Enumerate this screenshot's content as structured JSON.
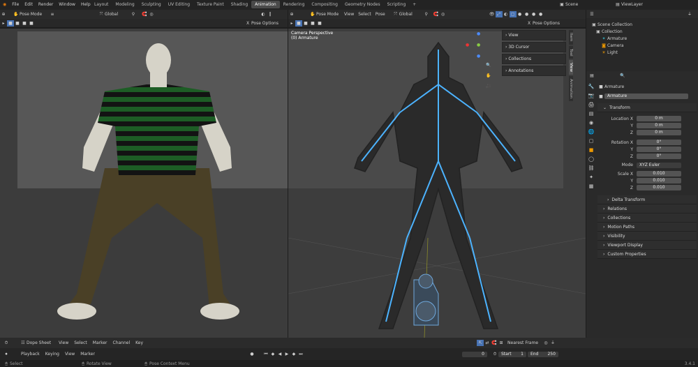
{
  "menu": [
    "File",
    "Edit",
    "Render",
    "Window",
    "Help"
  ],
  "workspaces": [
    "Layout",
    "Modeling",
    "Sculpting",
    "UV Editing",
    "Texture Paint",
    "Shading",
    "Animation",
    "Rendering",
    "Compositing",
    "Geometry Nodes",
    "Scripting",
    "+"
  ],
  "active_workspace": "Animation",
  "scene": "Scene",
  "view_layer": "ViewLayer",
  "left_header": {
    "mode": "Pose Mode",
    "transform": "Global"
  },
  "right_header": {
    "mode": "Pose Mode",
    "menus": [
      "View",
      "Select",
      "Pose"
    ],
    "transform": "Global"
  },
  "pose_options": "Pose Options",
  "pose_options_right": "Pose Options",
  "camera_overlay": {
    "line1": "Camera Perspective",
    "line2": "(0) Armature"
  },
  "npanel": [
    "View",
    "3D Cursor",
    "Collections",
    "Annotations"
  ],
  "side_tabs": [
    "Item",
    "Tool",
    "View",
    "Animation"
  ],
  "outliner": {
    "root": "Scene Collection",
    "collection": "Collection",
    "items": [
      "Armature",
      "Camera",
      "Light"
    ]
  },
  "properties": {
    "object_name": "Armature",
    "data_name": "Armature",
    "transform_label": "Transform",
    "location_label": "Location X",
    "location": [
      "0 m",
      "0 m",
      "0 m"
    ],
    "rotation_label": "Rotation X",
    "rotation": [
      "0°",
      "0°",
      "0°"
    ],
    "axes": [
      "Y",
      "Z"
    ],
    "mode_label": "Mode",
    "mode_value": "XYZ Euler",
    "scale_label": "Scale X",
    "scale": [
      "0.010",
      "0.010",
      "0.010"
    ],
    "delta": "Delta Transform",
    "sections": [
      "Relations",
      "Collections",
      "Motion Paths",
      "Visibility",
      "Viewport Display",
      "Custom Properties"
    ]
  },
  "dopesheet": {
    "mode": "Dope Sheet",
    "menus": [
      "View",
      "Select",
      "Marker",
      "Channel",
      "Key"
    ],
    "snap": "Nearest Frame"
  },
  "timeline": {
    "menus": [
      "Playback",
      "Keying",
      "View",
      "Marker"
    ],
    "current": "0",
    "start_label": "Start",
    "start": "1",
    "end_label": "End",
    "end": "250"
  },
  "status": {
    "select": "Select",
    "rotate": "Rotate View",
    "context": "Pose Context Menu",
    "version": "3.4.1"
  }
}
